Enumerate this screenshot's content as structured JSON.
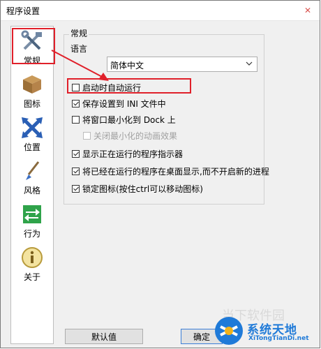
{
  "window": {
    "title": "程序设置"
  },
  "sidebar": {
    "items": [
      {
        "label": "常规",
        "icon": "tools-icon"
      },
      {
        "label": "图标",
        "icon": "box-icon"
      },
      {
        "label": "位置",
        "icon": "arrows-icon"
      },
      {
        "label": "风格",
        "icon": "brush-icon"
      },
      {
        "label": "行为",
        "icon": "swap-icon"
      },
      {
        "label": "关于",
        "icon": "info-icon"
      }
    ]
  },
  "general": {
    "group_title": "常规",
    "language_label": "语言",
    "language_value": "简体中文",
    "options": [
      {
        "label": "启动时自动运行",
        "checked": false
      },
      {
        "label": "保存设置到 INI 文件中",
        "checked": true
      },
      {
        "label": "将窗口最小化到 Dock 上",
        "checked": false
      },
      {
        "label": "关闭最小化的动画效果",
        "checked": false,
        "disabled": true
      },
      {
        "label": "显示正在运行的程序指示器",
        "checked": true
      },
      {
        "label": "将已经在运行的程序在桌面显示,而不开启新的进程",
        "checked": true
      },
      {
        "label": "锁定图标(按住ctrl可以移动图标)",
        "checked": true
      }
    ]
  },
  "buttons": {
    "defaults": "默认值",
    "ok": "确定"
  },
  "watermark": {
    "faint": "当下软件园",
    "cn": "系统天地",
    "en": "XiTongTianDi.net"
  },
  "colors": {
    "highlight": "#e0202a",
    "accent": "#1f7ad8"
  }
}
